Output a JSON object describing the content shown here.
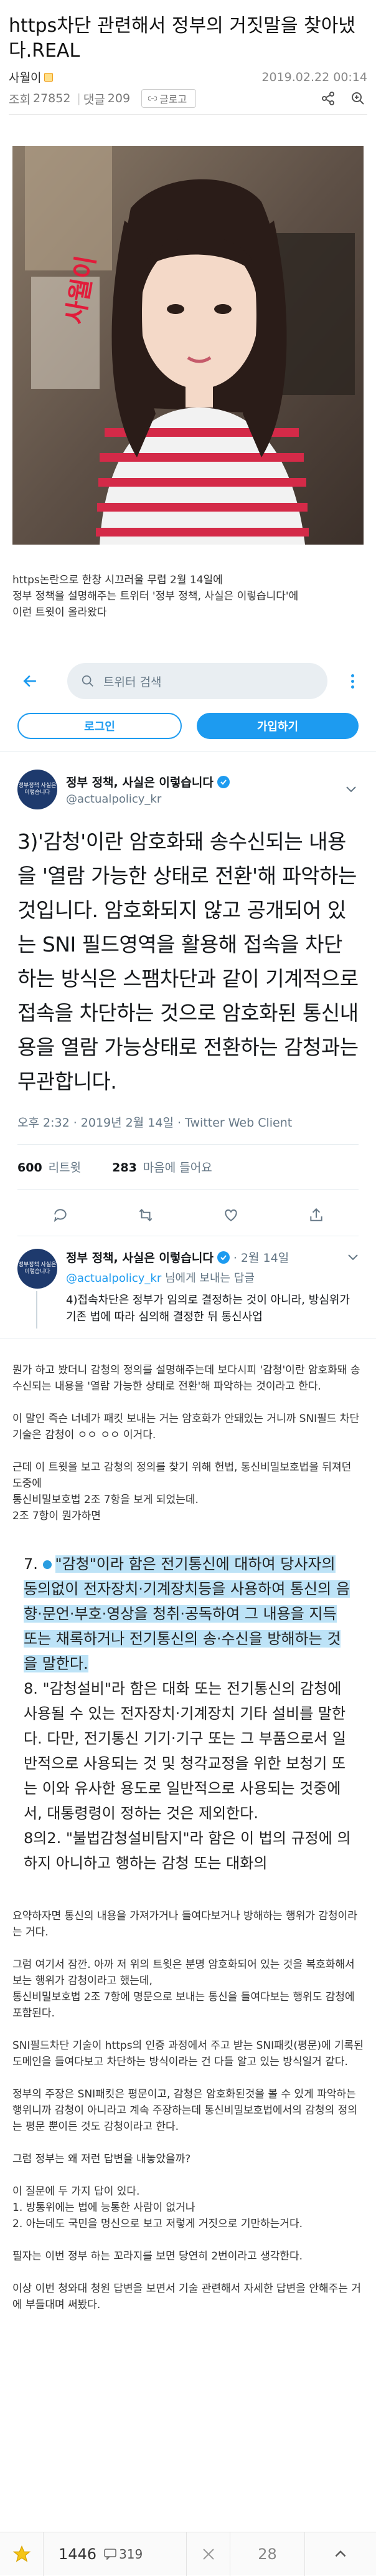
{
  "post": {
    "title": "https차단 관련해서 정부의 거짓말을 찾아냈다.REAL",
    "author": "사월이",
    "date": "2019.02.22 00:14",
    "views_label": "조회",
    "views": "27852",
    "comments_label": "댓글",
    "comments": "209",
    "link_label": "글로고"
  },
  "photo": {
    "caption": "사월이"
  },
  "intro": {
    "line1": "https논란으로 한창 시끄러울 무렵 2월 14일에",
    "line2": "정부 정책을 설명해주는 트위터 '정부 정책, 사실은 이렇습니다'에",
    "line3": "이런 트윗이 올라왔다"
  },
  "twitter": {
    "search_placeholder": "트위터 검색",
    "login": "로그인",
    "join": "가입하기",
    "account_name": "정부 정책, 사실은 이렇습니다",
    "handle": "@actualpolicy_kr",
    "avatar_text": "정부정책 사실은 이렇습니다",
    "tweet": "3)'감청'이란 암호화돼 송수신되는 내용을 '열람 가능한 상태로 전환'해 파악하는 것입니다. 암호화되지 않고 공개되어 있는 SNI 필드영역을 활용해 접속을 차단하는 방식은 스팸차단과 같이 기계적으로 접속을 차단하는 것으로 암호화된 통신내용을 열람 가능상태로 전환하는 감청과는 무관합니다.",
    "meta": "오후 2:32 · 2019년 2월 14일 · Twitter Web Client",
    "retweets": "600",
    "retweets_label": "리트윗",
    "likes": "283",
    "likes_label": "마음에 들어요",
    "reply": {
      "name": "정부 정책, 사실은 이렇습니다",
      "date": "· 2월 14일",
      "handle": "@actualpolicy_kr",
      "to_label": "님에게 보내는 답글",
      "text": "4)접속차단은 정부가 임의로 결정하는 것이 아니라, 방심위가 기존 법에 따라 심의해 결정한 뒤 통신사업"
    }
  },
  "section1": {
    "p1": "뭔가 하고 봤더니 감청의 정의를 설명해주는데 보다시피 '감청'이란 암호화돼 송수신되는 내용을 '열람 가능한 상태로 전환'해 파악하는 것이라고 한다.",
    "p2": "이 말인 즉슨 너네가 패킷 보내는 거는 암호화가 안돼있는 거니까 SNI필드 차단 기술은 감청이 ㅇㅇ ㅇㅇ 이거다.",
    "p3": "근데 이 트윗을 보고 감청의 정의를 찾기 위해 헌법, 통신비밀보호법을 뒤져던 도중에",
    "p4": "통신비밀보호법 2조 7항을 보게 되었는데.",
    "p5": "2조 7항이 뭔가하면"
  },
  "law": {
    "l1_num": "7.",
    "l1": "\"감청\"이라 함은 전기통신에 대하여 당사자의 동의없이 전자장치·기계장치등을 사용하여 통신의 음향·문언·부호·영상을 청취·공독하여 그 내용을 지득 또는 채록하거나 전기통신의 송·수신을 방해하는 것을 말한다.",
    "l2": "8. \"감청설비\"라 함은 대화 또는 전기통신의 감청에 사용될 수 있는 전자장치·기계장치 기타 설비를 말한다. 다만, 전기통신 기기·기구 또는 그 부품으로서 일반적으로 사용되는 것 및 청각교정을 위한 보청기 또는 이와 유사한 용도로 일반적으로 사용되는 것중에서, 대통령령이 정하는 것은 제외한다.",
    "l3": "8의2. \"불법감청설비탐지\"라 함은 이 법의 규정에 의하지 아니하고 행하는 감청 또는 대화의"
  },
  "section2": {
    "p1": "요약하자면 통신의 내용을 가져가거나 들여다보거나 방해하는 행위가 감청이라는 거다.",
    "p2": "그럼 여기서 잠깐. 아까 저 위의 트윗은 분명 암호화되어 있는 것을 복호화해서 보는 행위가 감청이라고 했는데,",
    "p3": "통신비밀보호법 2조 7항에 명문으로 보내는 통신을 들여다보는 행위도 감청에 포함된다.",
    "p4": "SNI필드차단 기술이 https의 인증 과정에서 주고 받는 SNI패킷(평문)에 기록된 도메인을 들여다보고 차단하는 방식이라는 건 다들 알고 있는 방식일거 같다.",
    "p5": "정부의 주장은 SNI패킷은 평문이고, 감청은 암호화된것을 볼 수 있게 파악하는 행위니까 감청이 아니라고 계속 주장하는데 통신비밀보호법에서의 감청의 정의는 평문 뿐이든 것도 감청이라고 한다.",
    "p6": "그럼 정부는 왜 저런 답변을 내놓았을까?",
    "p7": "이 질문에 두 가지 답이 있다.",
    "p8": "1. 방통위에는 법에 능통한 사람이 없거나",
    "p9": "2. 아는데도 국민을 멍신으로 보고 저렇게 거짓으로 기만하는거다.",
    "p10": "필자는 이번 정부 하는 꼬라지를 보면 당연히 2번이라고 생각한다.",
    "p11": "이상 이번 청와대 청원 답변을 보면서 기술 관련해서 자세한 답변을 안해주는 거에 부들대며 써봤다."
  },
  "bottom": {
    "votes": "1446",
    "comments": "319",
    "page": "28"
  }
}
